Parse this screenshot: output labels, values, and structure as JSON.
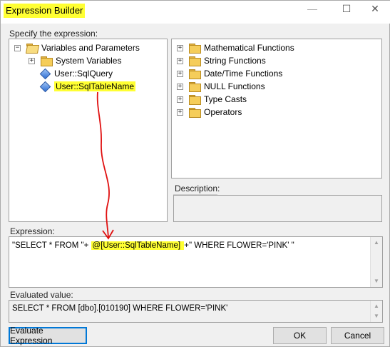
{
  "window": {
    "title": "Expression Builder",
    "controls": {
      "minimize": "—",
      "maximize": "☐",
      "close": "✕"
    }
  },
  "specify_label": "Specify the expression:",
  "variables_tree": {
    "root": "Variables and Parameters",
    "items": [
      {
        "label": "System Variables",
        "type": "folder"
      },
      {
        "label": "User::SqlQuery",
        "type": "variable"
      },
      {
        "label": "User::SqlTableName",
        "type": "variable",
        "highlighted": true
      }
    ]
  },
  "functions_tree": {
    "items": [
      "Mathematical Functions",
      "String Functions",
      "Date/Time Functions",
      "NULL Functions",
      "Type Casts",
      "Operators"
    ]
  },
  "description_label": "Description:",
  "expression": {
    "label": "Expression:",
    "part1": "\"SELECT * FROM \"+ ",
    "part2": "@[User::SqlTableName] ",
    "part3": " +\" WHERE FLOWER='PINK' \""
  },
  "evaluated": {
    "label": "Evaluated value:",
    "value": "SELECT * FROM [dbo].[010190] WHERE FLOWER='PINK'"
  },
  "buttons": {
    "evaluate": "Evaluate Expression",
    "ok": "OK",
    "cancel": "Cancel"
  },
  "annotation": {
    "color": "#e01010",
    "highlight": "#ffff33"
  },
  "expander_glyphs": {
    "collapsed": "+",
    "expanded": "−"
  }
}
